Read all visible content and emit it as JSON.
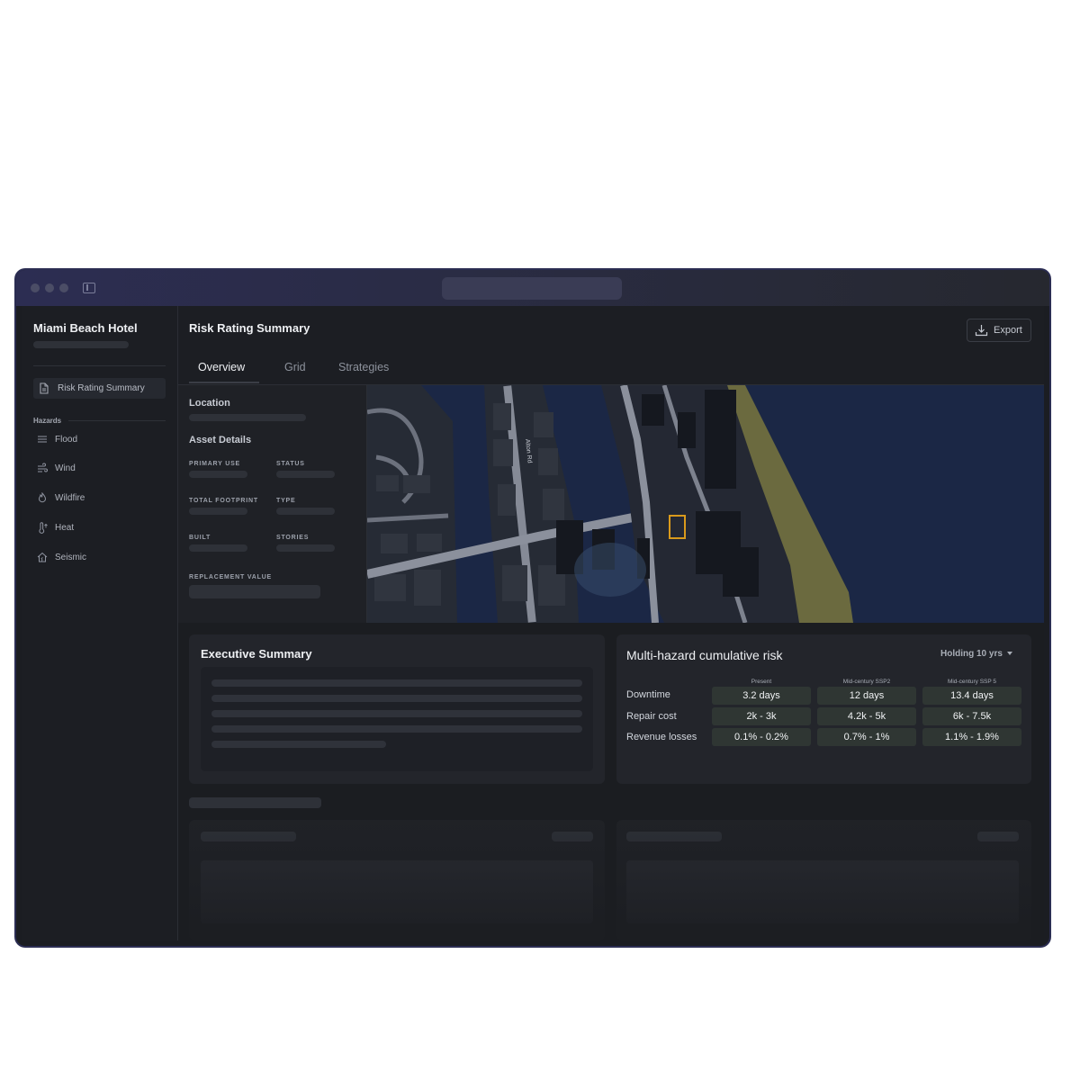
{
  "sidebar": {
    "app_title": "Miami Beach Hotel",
    "active_item": {
      "label": "Risk Rating Summary",
      "icon": "document-icon"
    },
    "hazards_heading": "Hazards",
    "hazards": [
      {
        "label": "Flood",
        "icon": "flood-icon"
      },
      {
        "label": "Wind",
        "icon": "wind-icon"
      },
      {
        "label": "Wildfire",
        "icon": "wildfire-icon"
      },
      {
        "label": "Heat",
        "icon": "heat-icon"
      },
      {
        "label": "Seismic",
        "icon": "seismic-icon"
      }
    ]
  },
  "header": {
    "title": "Risk Rating Summary",
    "export_label": "Export"
  },
  "tabs": [
    {
      "label": "Overview",
      "active": true
    },
    {
      "label": "Grid",
      "active": false
    },
    {
      "label": "Strategies",
      "active": false
    }
  ],
  "info": {
    "location_label": "Location",
    "asset_details_label": "Asset Details",
    "fields": {
      "primary_use": "PRIMARY USE",
      "status": "STATUS",
      "total_footprint": "TOTAL FOOTPRINT",
      "type": "TYPE",
      "built": "BUILT",
      "stories": "STORIES",
      "replacement_value": "REPLACEMENT VALUE"
    }
  },
  "map": {
    "street_label": "Alton Rd",
    "highlight_color": "#d99a1c",
    "water_color": "#1b2745",
    "shore_color": "#6b6a3f"
  },
  "executive_summary": {
    "title": "Executive Summary"
  },
  "risk": {
    "title": "Multi-hazard cumulative risk",
    "holding_label": "Holding 10 yrs",
    "columns": [
      "Present",
      "Mid-century SSP2",
      "Mid-century SSP 5"
    ],
    "rows": [
      {
        "label": "Downtime",
        "values": [
          "3.2 days",
          "12 days",
          "13.4 days"
        ]
      },
      {
        "label": "Repair cost",
        "values": [
          "2k - 3k",
          "4.2k - 5k",
          "6k - 7.5k"
        ]
      },
      {
        "label": "Revenue losses",
        "values": [
          "0.1% - 0.2%",
          "0.7% - 1%",
          "1.1% - 1.9%"
        ]
      }
    ],
    "cell_color": "#2f3633"
  },
  "colors": {
    "background": "#1c1e23",
    "titlebar_accent": "#2c2d52",
    "text_primary": "#eef0f3"
  }
}
